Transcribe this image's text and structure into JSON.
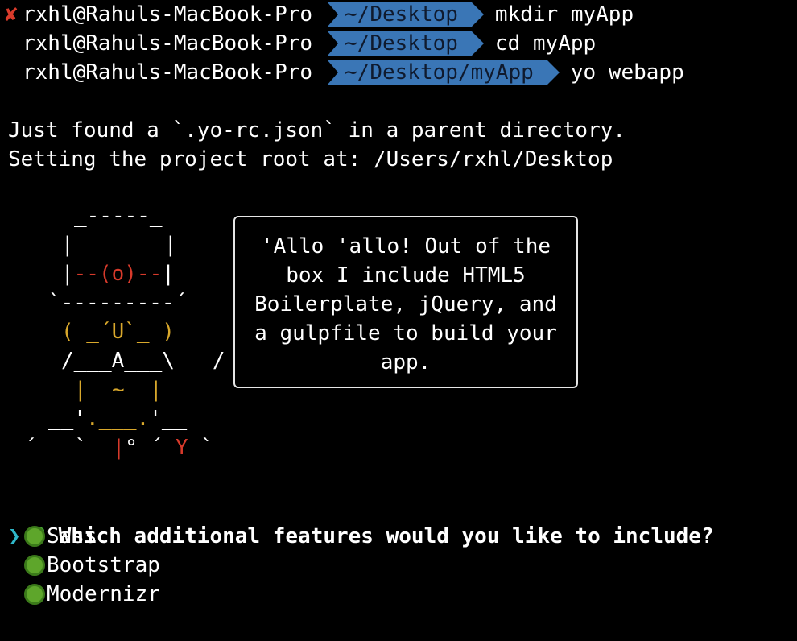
{
  "prompts": [
    {
      "status_icon": "x-mark-icon",
      "status": "✘",
      "user": "rxhl@Rahuls-MacBook-Pro",
      "path": "~/Desktop",
      "command": "mkdir myApp"
    },
    {
      "status": "",
      "user": "rxhl@Rahuls-MacBook-Pro",
      "path": "~/Desktop",
      "command": "cd myApp"
    },
    {
      "status": "",
      "user": "rxhl@Rahuls-MacBook-Pro",
      "path": "~/Desktop/myApp",
      "command": "yo webapp"
    }
  ],
  "output": {
    "line1": "Just found a `.yo-rc.json` in a parent directory.",
    "line2": "Setting the project root at: /Users/rxhl/Desktop"
  },
  "yeoman": {
    "art": {
      "row1": "_-----_",
      "row2a": "|",
      "row2b": "|",
      "row3a": "|",
      "row3b": "--(o)--",
      "row3c": "|",
      "row4": "`---------´",
      "row5": "( _´U`_ )",
      "row6": "/___A___\\   /",
      "row7": "|  ~  |",
      "row8a": "__'",
      "row8b": ".___.",
      "row8c": "'__",
      "row9a": "´   `  ",
      "row9b": "|",
      "row9c": "° ´ ",
      "row9d": "Y",
      "row9e": " `"
    },
    "speech": {
      "l1": "'Allo 'allo! Out of the",
      "l2": "box I include HTML5",
      "l3": "Boilerplate, jQuery, and",
      "l4": "a gulpfile to build your",
      "l5": "app."
    }
  },
  "question": {
    "mark": "?",
    "text": "Which additional features would you like to include?"
  },
  "options": [
    {
      "label": "Sass",
      "selected_pointer": "❯",
      "checked": true
    },
    {
      "label": "Bootstrap",
      "checked": true
    },
    {
      "label": "Modernizr",
      "checked": true
    }
  ],
  "colors": {
    "background": "#000000",
    "path_segment": "#3a76b6",
    "error_mark": "#d93b2b",
    "question_mark": "#45a734",
    "pointer": "#2fb7c9",
    "radio_checked": "#5ea62b",
    "yeoman_red": "#d73a2b",
    "yeoman_yellow": "#d9a82c"
  }
}
